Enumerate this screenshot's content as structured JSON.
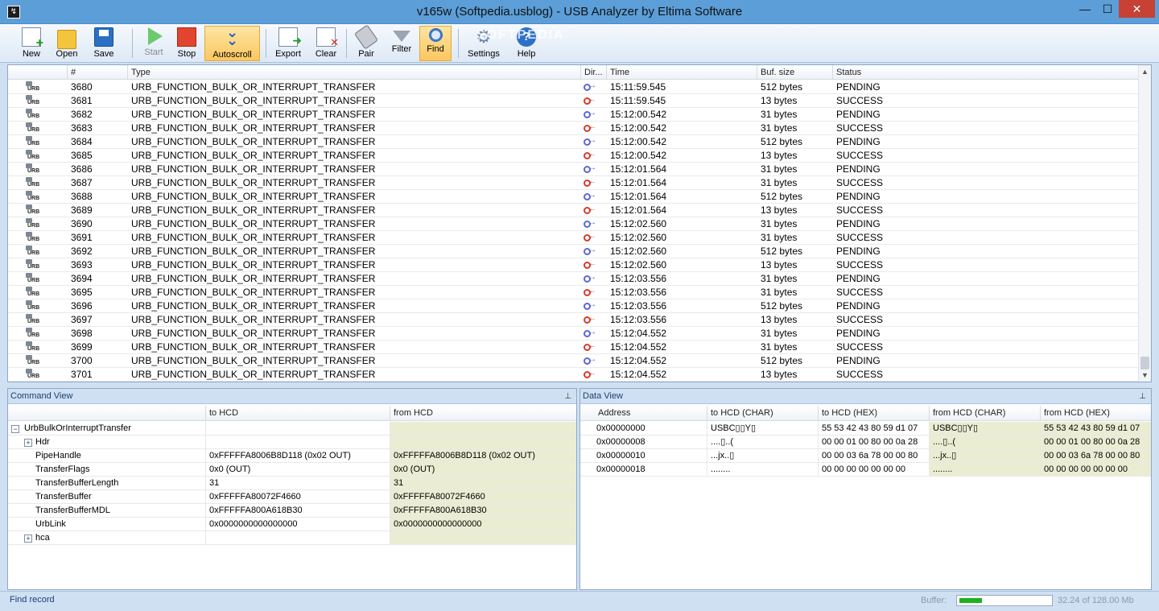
{
  "window": {
    "title": "v165w (Softpedia.usblog) - USB Analyzer by Eltima Software",
    "minimize": "—",
    "maximize": "☐",
    "close": "✕"
  },
  "toolbar": {
    "new": "New",
    "open": "Open",
    "save": "Save",
    "start": "Start",
    "stop": "Stop",
    "autoscroll": "Autoscroll",
    "export": "Export",
    "clear": "Clear",
    "pair": "Pair",
    "filter": "Filter",
    "find": "Find",
    "settings": "Settings",
    "help": "Help",
    "watermark": "SOFTPEDIA"
  },
  "list": {
    "columns": [
      "#",
      "Type",
      "Dir...",
      "Time",
      "Buf. size",
      "Status"
    ],
    "urb_label": "URB",
    "rows": [
      {
        "num": "3680",
        "type": "URB_FUNCTION_BULK_OR_INTERRUPT_TRANSFER",
        "dir": "out",
        "time": "15:11:59.545",
        "size": "512 bytes",
        "status": "PENDING"
      },
      {
        "num": "3681",
        "type": "URB_FUNCTION_BULK_OR_INTERRUPT_TRANSFER",
        "dir": "in",
        "time": "15:11:59.545",
        "size": "13 bytes",
        "status": "SUCCESS"
      },
      {
        "num": "3682",
        "type": "URB_FUNCTION_BULK_OR_INTERRUPT_TRANSFER",
        "dir": "out",
        "time": "15:12:00.542",
        "size": "31 bytes",
        "status": "PENDING"
      },
      {
        "num": "3683",
        "type": "URB_FUNCTION_BULK_OR_INTERRUPT_TRANSFER",
        "dir": "in",
        "time": "15:12:00.542",
        "size": "31 bytes",
        "status": "SUCCESS"
      },
      {
        "num": "3684",
        "type": "URB_FUNCTION_BULK_OR_INTERRUPT_TRANSFER",
        "dir": "out",
        "time": "15:12:00.542",
        "size": "512 bytes",
        "status": "PENDING"
      },
      {
        "num": "3685",
        "type": "URB_FUNCTION_BULK_OR_INTERRUPT_TRANSFER",
        "dir": "in",
        "time": "15:12:00.542",
        "size": "13 bytes",
        "status": "SUCCESS"
      },
      {
        "num": "3686",
        "type": "URB_FUNCTION_BULK_OR_INTERRUPT_TRANSFER",
        "dir": "out",
        "time": "15:12:01.564",
        "size": "31 bytes",
        "status": "PENDING"
      },
      {
        "num": "3687",
        "type": "URB_FUNCTION_BULK_OR_INTERRUPT_TRANSFER",
        "dir": "in",
        "time": "15:12:01.564",
        "size": "31 bytes",
        "status": "SUCCESS"
      },
      {
        "num": "3688",
        "type": "URB_FUNCTION_BULK_OR_INTERRUPT_TRANSFER",
        "dir": "out",
        "time": "15:12:01.564",
        "size": "512 bytes",
        "status": "PENDING"
      },
      {
        "num": "3689",
        "type": "URB_FUNCTION_BULK_OR_INTERRUPT_TRANSFER",
        "dir": "in",
        "time": "15:12:01.564",
        "size": "13 bytes",
        "status": "SUCCESS"
      },
      {
        "num": "3690",
        "type": "URB_FUNCTION_BULK_OR_INTERRUPT_TRANSFER",
        "dir": "out",
        "time": "15:12:02.560",
        "size": "31 bytes",
        "status": "PENDING"
      },
      {
        "num": "3691",
        "type": "URB_FUNCTION_BULK_OR_INTERRUPT_TRANSFER",
        "dir": "in",
        "time": "15:12:02.560",
        "size": "31 bytes",
        "status": "SUCCESS"
      },
      {
        "num": "3692",
        "type": "URB_FUNCTION_BULK_OR_INTERRUPT_TRANSFER",
        "dir": "out",
        "time": "15:12:02.560",
        "size": "512 bytes",
        "status": "PENDING"
      },
      {
        "num": "3693",
        "type": "URB_FUNCTION_BULK_OR_INTERRUPT_TRANSFER",
        "dir": "in",
        "time": "15:12:02.560",
        "size": "13 bytes",
        "status": "SUCCESS"
      },
      {
        "num": "3694",
        "type": "URB_FUNCTION_BULK_OR_INTERRUPT_TRANSFER",
        "dir": "out",
        "time": "15:12:03.556",
        "size": "31 bytes",
        "status": "PENDING"
      },
      {
        "num": "3695",
        "type": "URB_FUNCTION_BULK_OR_INTERRUPT_TRANSFER",
        "dir": "in",
        "time": "15:12:03.556",
        "size": "31 bytes",
        "status": "SUCCESS"
      },
      {
        "num": "3696",
        "type": "URB_FUNCTION_BULK_OR_INTERRUPT_TRANSFER",
        "dir": "out",
        "time": "15:12:03.556",
        "size": "512 bytes",
        "status": "PENDING"
      },
      {
        "num": "3697",
        "type": "URB_FUNCTION_BULK_OR_INTERRUPT_TRANSFER",
        "dir": "in",
        "time": "15:12:03.556",
        "size": "13 bytes",
        "status": "SUCCESS"
      },
      {
        "num": "3698",
        "type": "URB_FUNCTION_BULK_OR_INTERRUPT_TRANSFER",
        "dir": "out",
        "time": "15:12:04.552",
        "size": "31 bytes",
        "status": "PENDING"
      },
      {
        "num": "3699",
        "type": "URB_FUNCTION_BULK_OR_INTERRUPT_TRANSFER",
        "dir": "in",
        "time": "15:12:04.552",
        "size": "31 bytes",
        "status": "SUCCESS"
      },
      {
        "num": "3700",
        "type": "URB_FUNCTION_BULK_OR_INTERRUPT_TRANSFER",
        "dir": "out",
        "time": "15:12:04.552",
        "size": "512 bytes",
        "status": "PENDING"
      },
      {
        "num": "3701",
        "type": "URB_FUNCTION_BULK_OR_INTERRUPT_TRANSFER",
        "dir": "in",
        "time": "15:12:04.552",
        "size": "13 bytes",
        "status": "SUCCESS"
      }
    ]
  },
  "command_view": {
    "title": "Command View",
    "columns": [
      "",
      "to HCD",
      "from HCD"
    ],
    "rows": [
      {
        "name": "UrbBulkOrInterruptTransfer",
        "to": "",
        "from": "",
        "indent": 0,
        "expander": "−"
      },
      {
        "name": "Hdr",
        "to": "",
        "from": "",
        "indent": 1,
        "expander": "+"
      },
      {
        "name": "PipeHandle",
        "to": "0xFFFFFA8006B8D118 (0x02 OUT)",
        "from": "0xFFFFFA8006B8D118 (0x02 OUT)",
        "indent": 2,
        "expander": ""
      },
      {
        "name": "TransferFlags",
        "to": "0x0 (OUT)",
        "from": "0x0 (OUT)",
        "indent": 2,
        "expander": ""
      },
      {
        "name": "TransferBufferLength",
        "to": "31",
        "from": "31",
        "indent": 2,
        "expander": ""
      },
      {
        "name": "TransferBuffer",
        "to": "0xFFFFFA80072F4660",
        "from": "0xFFFFFA80072F4660",
        "indent": 2,
        "expander": ""
      },
      {
        "name": "TransferBufferMDL",
        "to": "0xFFFFFA800A618B30",
        "from": "0xFFFFFA800A618B30",
        "indent": 2,
        "expander": ""
      },
      {
        "name": "UrbLink",
        "to": "0x0000000000000000",
        "from": "0x0000000000000000",
        "indent": 2,
        "expander": ""
      },
      {
        "name": "hca",
        "to": "",
        "from": "",
        "indent": 1,
        "expander": "+"
      }
    ]
  },
  "data_view": {
    "title": "Data View",
    "columns": [
      "Address",
      "to HCD (CHAR)",
      "to HCD (HEX)",
      "from HCD (CHAR)",
      "from HCD (HEX)"
    ],
    "rows": [
      {
        "addr": "0x00000000",
        "to_char": "USBC▯▯Y▯",
        "to_hex": "55 53 42 43 80 59 d1 07",
        "from_char": "USBC▯▯Y▯",
        "from_hex": "55 53 42 43 80 59 d1 07"
      },
      {
        "addr": "0x00000008",
        "to_char": "....▯..(",
        "to_hex": "00 00 01 00 80 00 0a 28",
        "from_char": "....▯..(",
        "from_hex": "00 00 01 00 80 00 0a 28"
      },
      {
        "addr": "0x00000010",
        "to_char": "...jx..▯",
        "to_hex": "00 00 03 6a 78 00 00 80",
        "from_char": "...jx..▯",
        "from_hex": "00 00 03 6a 78 00 00 80"
      },
      {
        "addr": "0x00000018",
        "to_char": "........",
        "to_hex": "00 00 00 00 00 00 00",
        "from_char": "........",
        "from_hex": "00 00 00 00 00 00 00"
      }
    ]
  },
  "status": {
    "text": "Find record",
    "buffer_label": "Buffer:",
    "buffer_info": "32.24 of 128.00 Mb",
    "buffer_fraction": 0.2519
  },
  "colors": {
    "accent": "#5c9ed8",
    "highlight": "#ebedd3",
    "dir_out": "#5b66d8",
    "dir_in": "#d53b2f"
  }
}
